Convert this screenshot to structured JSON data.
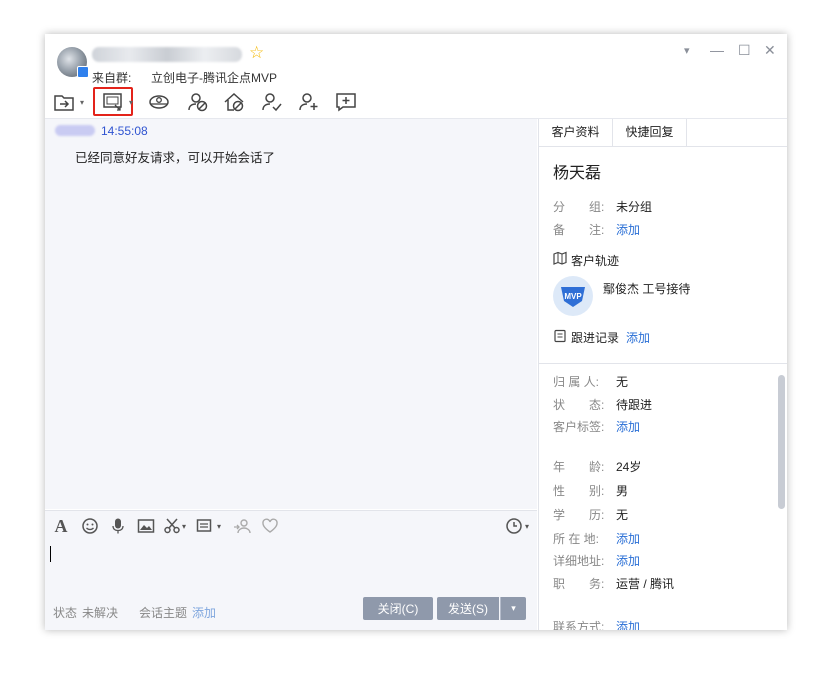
{
  "header": {
    "from_label": "来自群:",
    "from_group": "立创电子-腾讯企点MVP"
  },
  "window_controls": {
    "dropdown": "▾",
    "minimize": "—",
    "maximize": "☐",
    "close": "✕"
  },
  "toolbar": {
    "icons": [
      "transfer-icon",
      "screen-share-icon",
      "monitor-icon",
      "block-icon",
      "home-block-icon",
      "contact-check-icon",
      "add-contact-icon",
      "add-message-icon"
    ]
  },
  "chat": {
    "messages": [
      {
        "time": "14:55:08",
        "text": "已经同意好友请求，可以开始会话了"
      }
    ]
  },
  "input_footer": {
    "status_label": "状态",
    "status_value": "未解决",
    "topic_label": "会话主题",
    "topic_action": "添加",
    "close_button": "关闭(C)",
    "send_button": "发送(S)"
  },
  "sidebar": {
    "tabs": [
      "客户资料",
      "快捷回复"
    ],
    "customer_name": "杨天磊",
    "group_label": "分　　组:",
    "group_value": "未分组",
    "note_label": "备　　注:",
    "note_action": "添加",
    "track_title": "客户轨迹",
    "track_text": "鄢俊杰 工号接待",
    "followup_title": "跟进记录",
    "followup_action": "添加",
    "details": [
      {
        "label": "归 属 人:",
        "value": "无",
        "link": false
      },
      {
        "label": "状　　态:",
        "value": "待跟进",
        "link": false
      },
      {
        "label": "客户标签:",
        "value": "添加",
        "link": true
      },
      {
        "label": "年　　龄:",
        "value": "24岁",
        "link": false
      },
      {
        "label": "性　　别:",
        "value": "男",
        "link": false
      },
      {
        "label": "学　　历:",
        "value": "无",
        "link": false
      },
      {
        "label": "所 在 地:",
        "value": "添加",
        "link": true
      },
      {
        "label": "详细地址:",
        "value": "添加",
        "link": true
      },
      {
        "label": "职　　务:",
        "value": "运营 / 腾讯",
        "link": false
      },
      {
        "label": "联系方式:",
        "value": "添加",
        "link": true
      }
    ]
  },
  "colors": {
    "accent_blue": "#2a6fd6",
    "highlight_red": "#e3231a",
    "button_gray": "#8f99ab",
    "star": "#f5b800"
  }
}
